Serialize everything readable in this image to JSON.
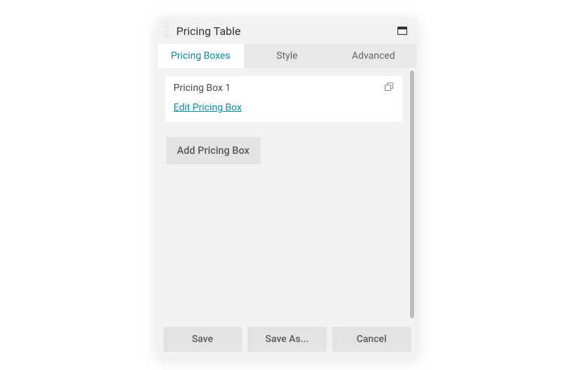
{
  "header": {
    "title": "Pricing Table"
  },
  "tabs": [
    {
      "label": "Pricing Boxes",
      "active": true
    },
    {
      "label": "Style",
      "active": false
    },
    {
      "label": "Advanced",
      "active": false
    }
  ],
  "pricingBoxes": [
    {
      "title": "Pricing Box 1",
      "editLabel": "Edit Pricing Box"
    }
  ],
  "addButton": {
    "label": "Add Pricing Box"
  },
  "footer": {
    "save": "Save",
    "saveAs": "Save As...",
    "cancel": "Cancel"
  }
}
